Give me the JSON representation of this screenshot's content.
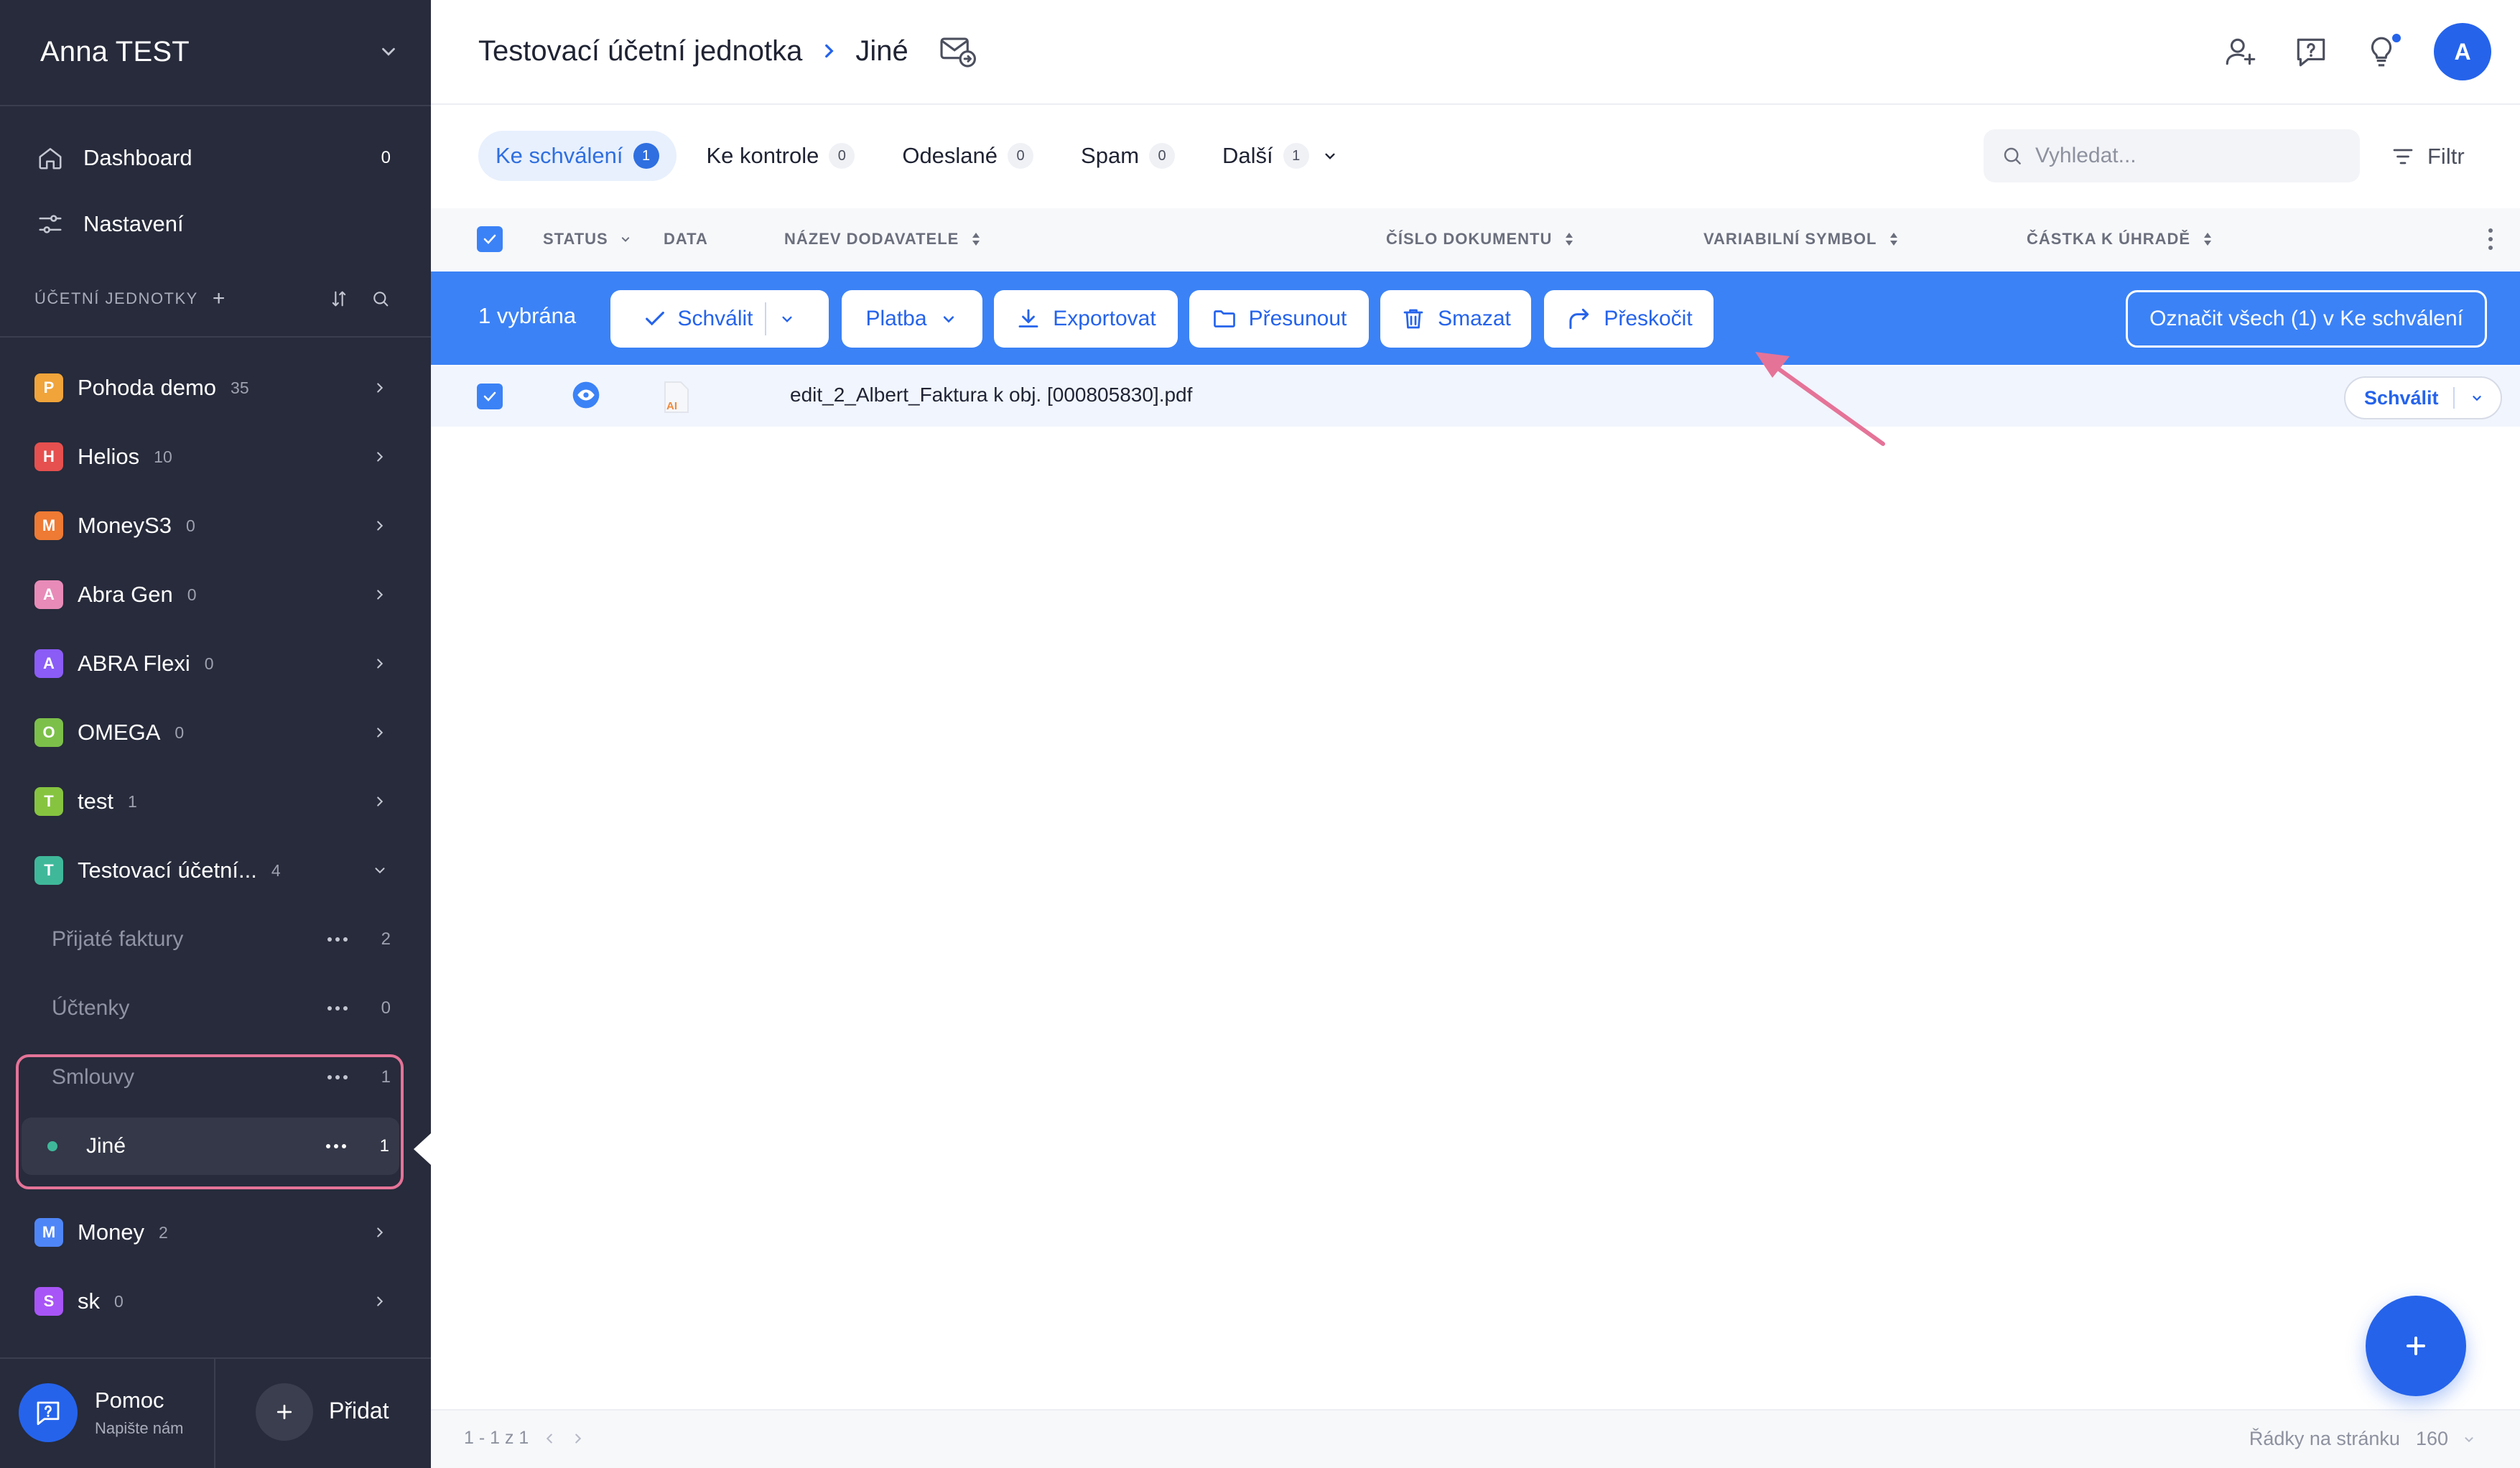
{
  "sidebar": {
    "user_name": "Anna TEST",
    "nav": [
      {
        "label": "Dashboard",
        "count": "0"
      },
      {
        "label": "Nastavení",
        "count": ""
      }
    ],
    "section_title": "ÚČETNÍ JEDNOTKY",
    "units": [
      {
        "letter": "P",
        "name": "Pohoda demo",
        "count": "35",
        "color": "#f0a43a"
      },
      {
        "letter": "H",
        "name": "Helios",
        "count": "10",
        "color": "#e6504e"
      },
      {
        "letter": "M",
        "name": "MoneyS3",
        "count": "0",
        "color": "#ee7a33"
      },
      {
        "letter": "A",
        "name": "Abra Gen",
        "count": "0",
        "color": "#e88bb8"
      },
      {
        "letter": "A",
        "name": "ABRA Flexi",
        "count": "0",
        "color": "#8b5cf6"
      },
      {
        "letter": "O",
        "name": "OMEGA",
        "count": "0",
        "color": "#7cc04a"
      },
      {
        "letter": "T",
        "name": "test",
        "count": "1",
        "color": "#86c440"
      },
      {
        "letter": "T",
        "name": "Testovací účetní...",
        "count": "4",
        "color": "#3fb89a"
      }
    ],
    "subfolders": [
      {
        "name": "Přijaté faktury",
        "count": "2"
      },
      {
        "name": "Účtenky",
        "count": "0"
      },
      {
        "name": "Smlouvy",
        "count": "1"
      },
      {
        "name": "Jiné",
        "count": "1"
      }
    ],
    "units_after": [
      {
        "letter": "M",
        "name": "Money",
        "count": "2",
        "color": "#4f86f7"
      },
      {
        "letter": "S",
        "name": "sk",
        "count": "0",
        "color": "#a855f7"
      }
    ],
    "help_title": "Pomoc",
    "help_subtitle": "Napište nám",
    "add_label": "Přidat"
  },
  "header": {
    "breadcrumb_parent": "Testovací účetní jednotka",
    "breadcrumb_current": "Jiné",
    "avatar_letter": "A"
  },
  "tabs": [
    {
      "label": "Ke schválení",
      "count": "1"
    },
    {
      "label": "Ke kontrole",
      "count": "0"
    },
    {
      "label": "Odeslané",
      "count": "0"
    },
    {
      "label": "Spam",
      "count": "0"
    },
    {
      "label": "Další",
      "count": "1"
    }
  ],
  "search": {
    "placeholder": "Vyhledat..."
  },
  "filter_label": "Filtr",
  "table": {
    "columns": [
      "STATUS",
      "DATA",
      "NÁZEV DODAVATELE",
      "ČÍSLO DOKUMENTU",
      "VARIABILNÍ SYMBOL",
      "ČÁSTKA K ÚHRADĚ"
    ],
    "rows": [
      {
        "filename": "edit_2_Albert_Faktura k obj. [000805830].pdf",
        "action": "Schválit",
        "file_badge": "AI"
      }
    ]
  },
  "actionbar": {
    "selected": "1 vybrána",
    "approve": "Schválit",
    "payment": "Platba",
    "export": "Exportovat",
    "move": "Přesunout",
    "delete": "Smazat",
    "skip": "Přeskočit",
    "mark_all": "Označit všech (1) v Ke schválení"
  },
  "footer": {
    "pagination": "1 - 1 z 1",
    "rows_per_page_label": "Řádky na stránku",
    "rows_per_page_value": "160"
  },
  "colors": {
    "sidebar_bg": "#272b3b",
    "accent": "#2563eb",
    "actionbar": "#3b82f6",
    "annotation": "#e57398"
  }
}
